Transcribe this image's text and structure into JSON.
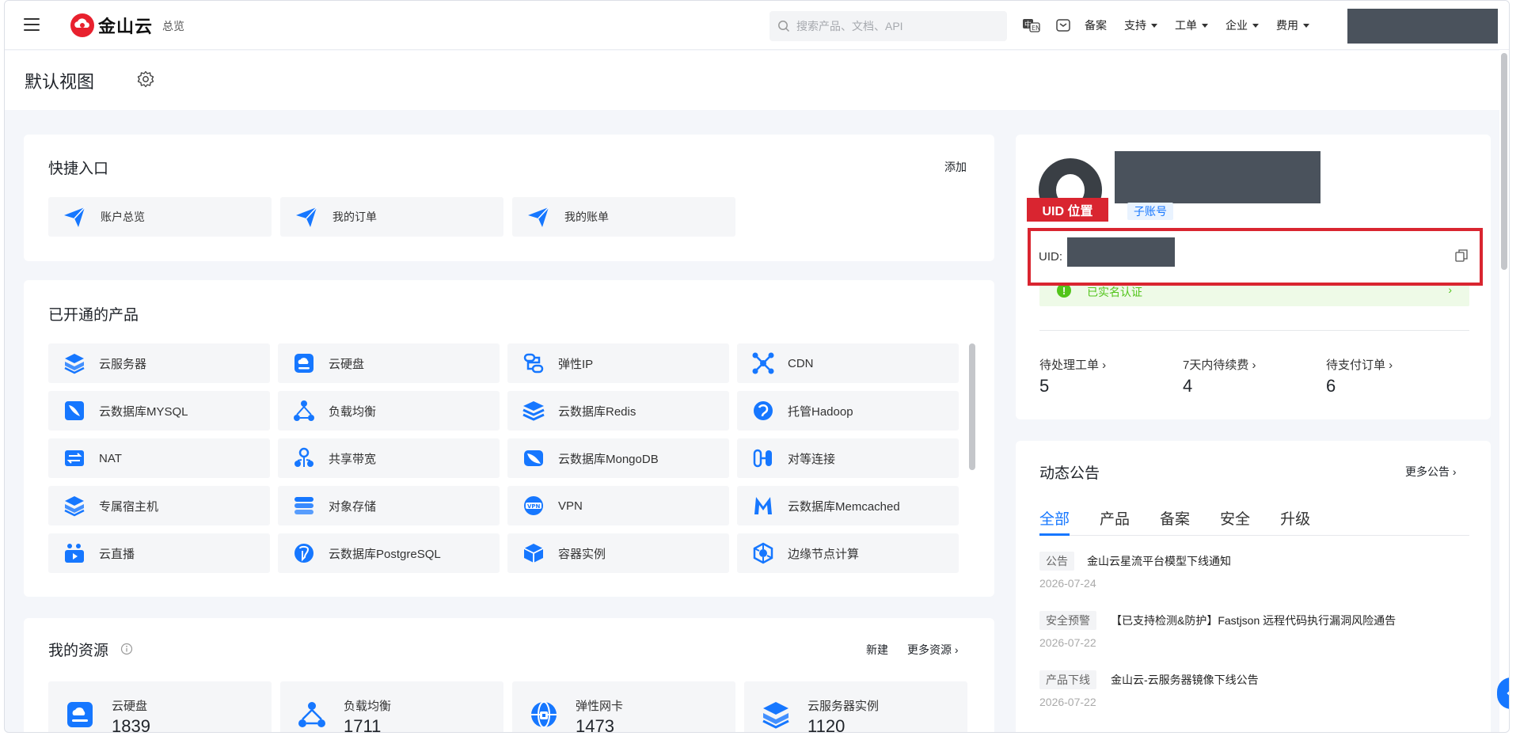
{
  "header": {
    "brand": "金山云",
    "overview": "总览",
    "search_placeholder": "搜索产品、文档、API",
    "nav": [
      "备案",
      "支持",
      "工单",
      "企业",
      "费用"
    ]
  },
  "page": {
    "title": "默认视图"
  },
  "quick": {
    "title": "快捷入口",
    "add": "添加",
    "items": [
      "账户总览",
      "我的订单",
      "我的账单"
    ]
  },
  "products": {
    "title": "已开通的产品",
    "items": [
      "云服务器",
      "云硬盘",
      "弹性IP",
      "CDN",
      "云数据库MYSQL",
      "负载均衡",
      "云数据库Redis",
      "托管Hadoop",
      "NAT",
      "共享带宽",
      "云数据库MongoDB",
      "对等连接",
      "专属宿主机",
      "对象存储",
      "VPN",
      "云数据库Memcached",
      "云直播",
      "云数据库PostgreSQL",
      "容器实例",
      "边缘节点计算"
    ]
  },
  "resources": {
    "title": "我的资源",
    "new": "新建",
    "more": "更多资源",
    "items": [
      {
        "name": "云硬盘",
        "count": "1839"
      },
      {
        "name": "负载均衡",
        "count": "1711"
      },
      {
        "name": "弹性网卡",
        "count": "1473"
      },
      {
        "name": "云服务器实例",
        "count": "1120"
      }
    ]
  },
  "profile": {
    "uid_tag": "UID 位置",
    "sub_account": "子账号",
    "uid_label": "UID:",
    "verified": "已实名认证",
    "stats": [
      {
        "label": "待处理工单",
        "value": "5"
      },
      {
        "label": "7天内待续费",
        "value": "4"
      },
      {
        "label": "待支付订单",
        "value": "6"
      }
    ]
  },
  "notices": {
    "title": "动态公告",
    "more": "更多公告",
    "tabs": [
      "全部",
      "产品",
      "备案",
      "安全",
      "升级"
    ],
    "items": [
      {
        "tag": "公告",
        "title": "金山云星流平台模型下线通知",
        "date": "2026-07-24"
      },
      {
        "tag": "安全预警",
        "title": "【已支持检测&防护】Fastjson 远程代码执行漏洞风险通告",
        "date": "2026-07-22"
      },
      {
        "tag": "产品下线",
        "title": "金山云-云服务器镜像下线公告",
        "date": "2026-07-22"
      }
    ]
  },
  "colors": {
    "accent": "#1677ff",
    "highlight": "#d92530",
    "brand": "#e8212e"
  }
}
